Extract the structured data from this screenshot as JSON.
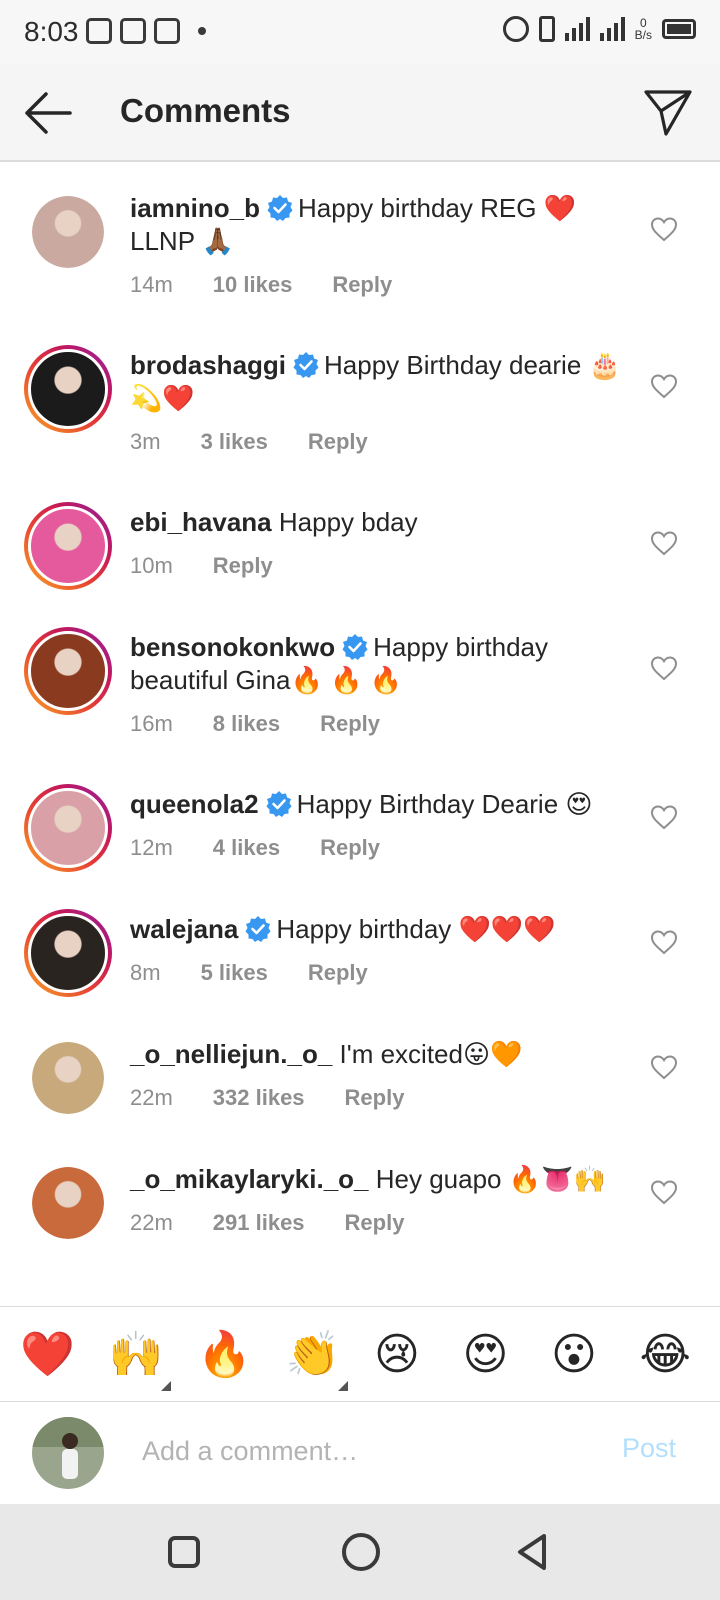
{
  "status_bar": {
    "time": "8:03",
    "network_speed": "0",
    "network_unit": "B/s",
    "network_type": "3G"
  },
  "header": {
    "title": "Comments"
  },
  "comments": [
    {
      "username": "iamnino_b",
      "verified": true,
      "text": "Happy birthday REG ❤️ LLNP 🙏🏾",
      "time": "14m",
      "likes": "10 likes",
      "reply": "Reply",
      "story_ring": false,
      "avatar_color": "#c9a9a0"
    },
    {
      "username": "brodashaggi",
      "verified": true,
      "text": "Happy Birthday dearie 🎂💫❤️",
      "time": "3m",
      "likes": "3 likes",
      "reply": "Reply",
      "story_ring": true,
      "avatar_color": "#1b1b1b"
    },
    {
      "username": "ebi_havana",
      "verified": false,
      "text": "Happy bday",
      "time": "10m",
      "likes": "",
      "reply": "Reply",
      "story_ring": true,
      "avatar_color": "#e45a9c"
    },
    {
      "username": "bensonokonkwo",
      "verified": true,
      "text": "Happy birthday beautiful Gina🔥 🔥 🔥",
      "time": "16m",
      "likes": "8 likes",
      "reply": "Reply",
      "story_ring": true,
      "avatar_color": "#8a3a1e"
    },
    {
      "username": "queenola2",
      "verified": true,
      "text": "Happy Birthday Dearie 😍",
      "time": "12m",
      "likes": "4 likes",
      "reply": "Reply",
      "story_ring": true,
      "avatar_color": "#d9a0a8"
    },
    {
      "username": "walejana",
      "verified": true,
      "text": "Happy birthday ❤️❤️❤️",
      "time": "8m",
      "likes": "5 likes",
      "reply": "Reply",
      "story_ring": true,
      "avatar_color": "#2a2420"
    },
    {
      "username": "_o_nelliejun._o_",
      "verified": false,
      "text": "I'm excited😛🧡",
      "time": "22m",
      "likes": "332 likes",
      "reply": "Reply",
      "story_ring": false,
      "avatar_color": "#c8a97c"
    },
    {
      "username": "_o_mikaylaryki._o_",
      "verified": false,
      "text": "Hey guapo 🔥👅🙌",
      "time": "22m",
      "likes": "291 likes",
      "reply": "Reply",
      "story_ring": false,
      "avatar_color": "#c96a3c"
    }
  ],
  "emoji_bar": [
    "❤️",
    "🙌",
    "🔥",
    "👏",
    "😢",
    "😍",
    "😮",
    "😂"
  ],
  "composer": {
    "placeholder": "Add a comment…",
    "post_label": "Post"
  },
  "colors": {
    "verified_blue": "#3897f0",
    "post_disabled": "#b2dffc",
    "meta_gray": "#8e8e8e"
  }
}
